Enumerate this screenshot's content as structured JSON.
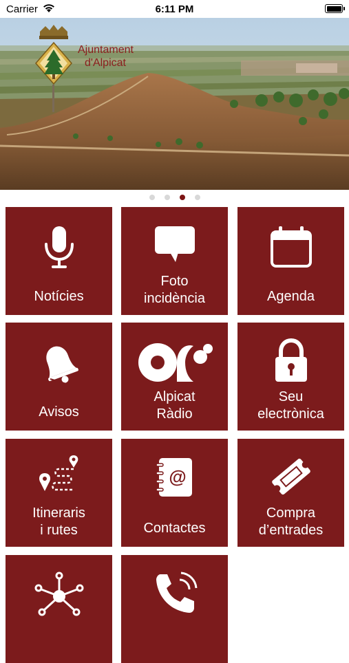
{
  "status": {
    "carrier": "Carrier",
    "time": "6:11 PM",
    "battery_level": 1.0
  },
  "banner": {
    "brand_line1": "Ajuntament",
    "brand_line2": "d'Alpicat",
    "slides_total": 4,
    "active_slide": 3
  },
  "menu": {
    "items": [
      {
        "icon": "microphone-icon",
        "lines": [
          "Notícies"
        ]
      },
      {
        "icon": "speech-bubble-icon",
        "lines": [
          "Foto",
          "incidència"
        ]
      },
      {
        "icon": "calendar-icon",
        "lines": [
          "Agenda"
        ]
      },
      {
        "icon": "bell-icon",
        "lines": [
          "Avisos"
        ]
      },
      {
        "icon": "radio-logo-icon",
        "lines": [
          "Alpicat",
          "Ràdio"
        ]
      },
      {
        "icon": "padlock-icon",
        "lines": [
          "Seu",
          "electrònica"
        ]
      },
      {
        "icon": "route-map-icon",
        "lines": [
          "Itineraris",
          "i rutes"
        ]
      },
      {
        "icon": "address-book-icon",
        "lines": [
          "Contactes"
        ]
      },
      {
        "icon": "ticket-icon",
        "lines": [
          "Compra",
          "d’entrades"
        ]
      },
      {
        "icon": "network-hub-icon",
        "lines": []
      },
      {
        "icon": "phone-icon",
        "lines": []
      }
    ]
  },
  "colors": {
    "tile_background": "#7c1b1c",
    "tile_foreground": "#ffffff",
    "active_dot": "#7c1414",
    "inactive_dot": "#d8d8d8",
    "brand_text": "#8b1e1e"
  }
}
